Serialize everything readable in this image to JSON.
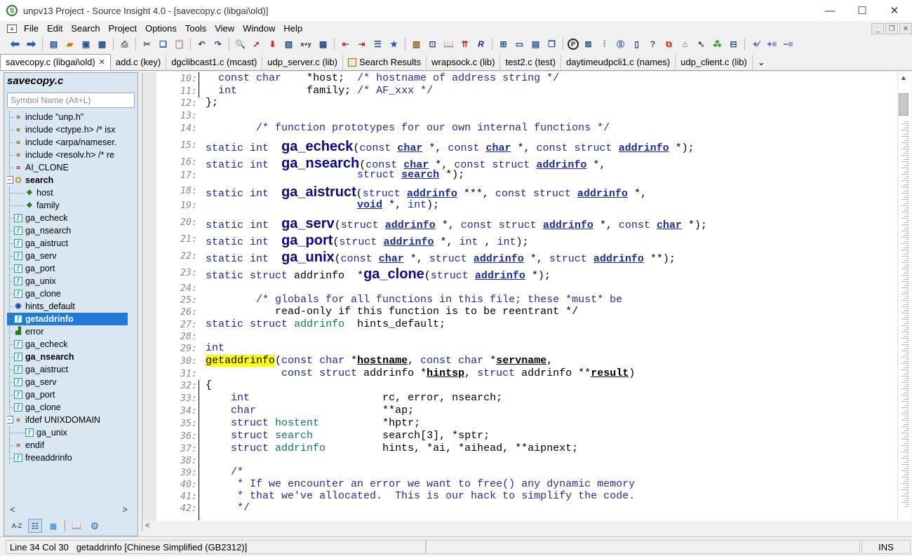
{
  "window": {
    "title": "unpv13 Project - Source Insight 4.0 - [savecopy.c (libgai\\old)]",
    "minimize": "—",
    "maximize": "☐",
    "close": "✕"
  },
  "menu": [
    "File",
    "Edit",
    "Search",
    "Project",
    "Options",
    "Tools",
    "View",
    "Window",
    "Help"
  ],
  "toolbar": {
    "icons": [
      "back-icon",
      "forward-icon",
      "new-file-icon",
      "open-icon",
      "save-icon",
      "save-all-icon",
      "print-icon",
      "cut-icon",
      "copy-icon",
      "paste-icon",
      "undo-icon",
      "redo-icon",
      "search-files-icon",
      "jump-icon",
      "lookup-icon",
      "browse-icon",
      "replace-xy-icon",
      "keyword-icon",
      "bookmark-prev-icon",
      "bookmark-next-icon",
      "bookmark-list-icon",
      "bookmark-icon",
      "symbol-icon",
      "relation-icon",
      "context-icon",
      "call-graph-icon",
      "r-icon",
      "layout1-icon",
      "layout2-icon",
      "layout3-icon",
      "layout4-icon",
      "p-icon",
      "project-icon",
      "tree-icon",
      "s-icon",
      "doc-icon",
      "help-icon",
      "window-icon",
      "clip-icon",
      "bird-icon",
      "grid-icon",
      "table-icon",
      "plus-minus-icon",
      "expand-icon",
      "collapse-icon"
    ],
    "replace_label": "x+y"
  },
  "tabs": [
    {
      "label": "savecopy.c (libgai\\old)",
      "active": true,
      "close": "✕"
    },
    {
      "label": "add.c (key)"
    },
    {
      "label": "dgclibcast1.c (mcast)"
    },
    {
      "label": "udp_server.c (lib)"
    },
    {
      "label": "Search Results"
    },
    {
      "label": "wrapsock.c (lib)"
    },
    {
      "label": "test2.c (test)"
    },
    {
      "label": "daytimeudpcli1.c (names)"
    },
    {
      "label": "udp_client.c (lib)"
    }
  ],
  "tab_overflow": "⌄",
  "symbol_panel": {
    "title": "savecopy.c",
    "search_placeholder": "Symbol Name (Alt+L)",
    "items": [
      {
        "label": "include \"unp.h\"",
        "icon": "include-icon",
        "indent": 0
      },
      {
        "label": "include <ctype.h> /* isx",
        "icon": "include-icon",
        "indent": 0
      },
      {
        "label": "include <arpa/nameser.",
        "icon": "include-icon",
        "indent": 0
      },
      {
        "label": "include <resolv.h> /* re",
        "icon": "include-icon",
        "indent": 0
      },
      {
        "label": "AI_CLONE",
        "icon": "define-icon",
        "indent": 0
      },
      {
        "label": "search",
        "icon": "struct-icon",
        "indent": 0,
        "bold": true,
        "expand": "⊟"
      },
      {
        "label": "host",
        "icon": "field-icon",
        "indent": 1
      },
      {
        "label": "family",
        "icon": "field-icon",
        "indent": 1
      },
      {
        "label": "ga_echeck",
        "icon": "function-icon",
        "indent": 0
      },
      {
        "label": "ga_nsearch",
        "icon": "function-icon",
        "indent": 0
      },
      {
        "label": "ga_aistruct",
        "icon": "function-icon",
        "indent": 0
      },
      {
        "label": "ga_serv",
        "icon": "function-icon",
        "indent": 0
      },
      {
        "label": "ga_port",
        "icon": "function-icon",
        "indent": 0
      },
      {
        "label": "ga_unix",
        "icon": "function-icon",
        "indent": 0
      },
      {
        "label": "ga_clone",
        "icon": "function-icon",
        "indent": 0
      },
      {
        "label": "hints_default",
        "icon": "variable-icon",
        "indent": 0
      },
      {
        "label": "getaddrinfo",
        "icon": "function-icon",
        "indent": 0,
        "selected": true
      },
      {
        "label": "error",
        "icon": "label-icon",
        "indent": 0
      },
      {
        "label": "ga_echeck",
        "icon": "function-icon",
        "indent": 0
      },
      {
        "label": "ga_nsearch",
        "icon": "function-icon",
        "indent": 0,
        "bold": true
      },
      {
        "label": "ga_aistruct",
        "icon": "function-icon",
        "indent": 0
      },
      {
        "label": "ga_serv",
        "icon": "function-icon",
        "indent": 0
      },
      {
        "label": "ga_port",
        "icon": "function-icon",
        "indent": 0
      },
      {
        "label": "ga_clone",
        "icon": "function-icon",
        "indent": 0
      },
      {
        "label": "ifdef UNIXDOMAIN",
        "icon": "include-icon",
        "indent": 0,
        "expand": "⊟"
      },
      {
        "label": "ga_unix",
        "icon": "function-icon",
        "indent": 1
      },
      {
        "label": "endif",
        "icon": "include-icon",
        "indent": 0
      },
      {
        "label": "freeaddrinfo",
        "icon": "function-icon",
        "indent": 0
      }
    ],
    "scroll_left": "<",
    "scroll_right": ">",
    "bottom_buttons": [
      "sort-az-icon",
      "list-view-icon",
      "category-icon",
      "book-icon",
      "gear-icon"
    ],
    "sort_label": "A-Z"
  },
  "editor": {
    "lines": [
      {
        "n": "10:",
        "t": "  const char    *host;  /* hostname of address string */"
      },
      {
        "n": "11:",
        "t": "  int           family; /* AF_xxx */"
      },
      {
        "n": "12:",
        "t": "};"
      },
      {
        "n": "13:",
        "t": ""
      },
      {
        "n": "14:",
        "t": "        /* function prototypes for our own internal functions */"
      },
      {
        "n": "15:",
        "t": "static int  ga_echeck(const char *, const char *, const struct addrinfo *);"
      },
      {
        "n": "16:",
        "t": "static int  ga_nsearch(const char *, const struct addrinfo *,"
      },
      {
        "n": "17:",
        "t": "                        struct search *);"
      },
      {
        "n": "18:",
        "t": "static int  ga_aistruct(struct addrinfo ***, const struct addrinfo *,"
      },
      {
        "n": "19:",
        "t": "                        void *, int);"
      },
      {
        "n": "20:",
        "t": "static int  ga_serv(struct addrinfo *, const struct addrinfo *, const char *);"
      },
      {
        "n": "21:",
        "t": "static int  ga_port(struct addrinfo *, int , int);"
      },
      {
        "n": "22:",
        "t": "static int  ga_unix(const char *, struct addrinfo *, struct addrinfo **);"
      },
      {
        "n": "23:",
        "t": "static struct addrinfo  *ga_clone(struct addrinfo *);"
      },
      {
        "n": "24:",
        "t": ""
      },
      {
        "n": "25:",
        "t": "        /* globals for all functions in this file; these *must* be"
      },
      {
        "n": "26:",
        "t": "           read-only if this function is to be reentrant */"
      },
      {
        "n": "27:",
        "t": "static struct addrinfo  hints_default;"
      },
      {
        "n": "28:",
        "t": ""
      },
      {
        "n": "29:",
        "t": "int"
      },
      {
        "n": "30:",
        "t": "getaddrinfo(const char *hostname, const char *servname,"
      },
      {
        "n": "31:",
        "t": "            const struct addrinfo *hintsp, struct addrinfo **result)"
      },
      {
        "n": "32:",
        "t": "{"
      },
      {
        "n": "33:",
        "t": "    int                     rc, error, nsearch;"
      },
      {
        "n": "34:",
        "t": "    char                    **ap;"
      },
      {
        "n": "35:",
        "t": "    struct hostent          *hptr;"
      },
      {
        "n": "36:",
        "t": "    struct search           search[3], *sptr;"
      },
      {
        "n": "37:",
        "t": "    struct addrinfo         hints, *ai, *aihead, **aipnext;"
      },
      {
        "n": "38:",
        "t": ""
      },
      {
        "n": "39:",
        "t": "    /*"
      },
      {
        "n": "40:",
        "t": "     * If we encounter an error we want to free() any dynamic memory"
      },
      {
        "n": "41:",
        "t": "     * that we've allocated.  This is our hack to simplify the code."
      },
      {
        "n": "42:",
        "t": "     */"
      }
    ],
    "scroll_up": "▲",
    "scroll_down": "▼",
    "scroll_left": "<"
  },
  "status": {
    "position": "Line 34  Col 30",
    "symbol": "getaddrinfo [Chinese Simplified (GB2312)]",
    "mode": "INS"
  }
}
